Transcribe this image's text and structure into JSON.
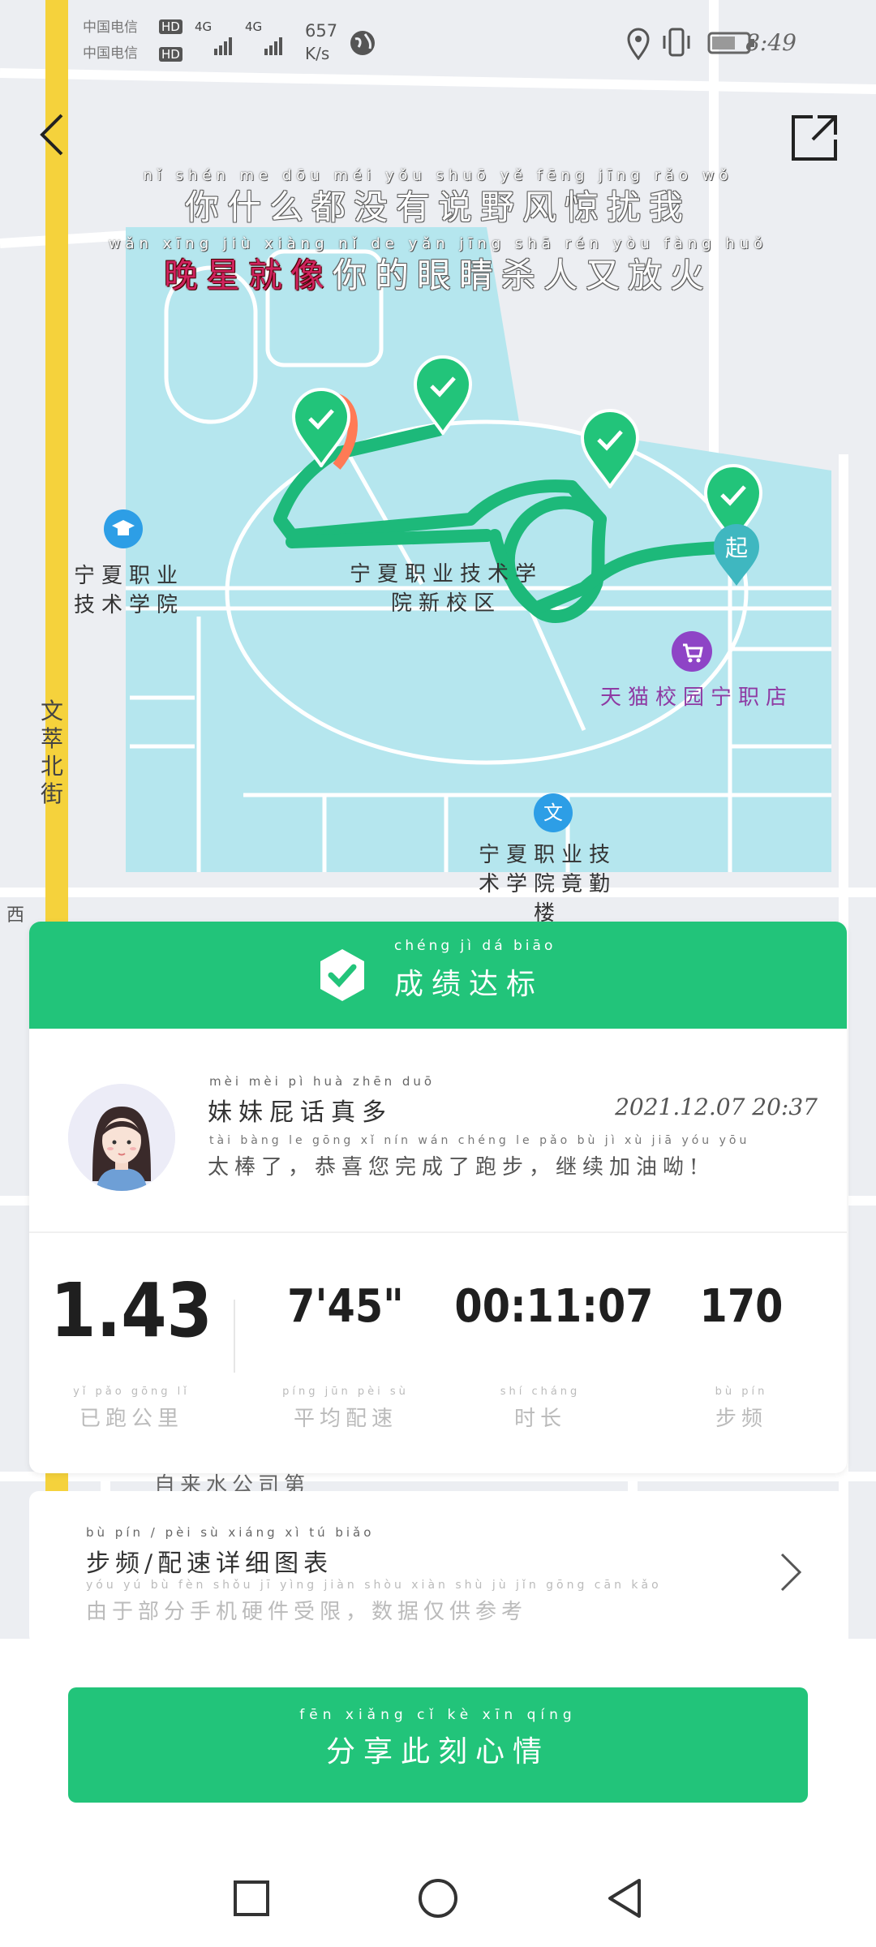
{
  "status_bar": {
    "carrier1": "中国电信",
    "carrier2": "中国电信",
    "hd1": "HD",
    "hd2": "HD",
    "net1": "4G",
    "net2": "4G",
    "speed": "657",
    "speed_unit": "K/s",
    "time": "8:49"
  },
  "lyrics": {
    "line1_pinyin": "nǐ shén me dōu méi yǒu shuō yě fēng jīng rǎo wǒ",
    "line1": "你什么都没有说野风惊扰我",
    "line2_pinyin": "wǎn xīng jiù xiàng nǐ de yǎn jīng shā rén yòu fàng huǒ",
    "line2_highlight": "晚星就像",
    "line2_rest": "你的眼睛杀人又放火"
  },
  "map": {
    "poi_school": "宁夏职业技术学院",
    "poi_new_campus": "宁夏职业技术学院新校区",
    "poi_shop": "天猫校园宁职店",
    "poi_library": "宁夏职业技术学院竟勤楼",
    "street": "文萃北街",
    "poi_water": "自来水公司第",
    "start_marker": "起",
    "edge_char": "西",
    "lib_icon": "文"
  },
  "result": {
    "title": "成绩达标",
    "title_pinyin": "chéng jì dá biāo",
    "user_name": "妹妹屁话真多",
    "user_name_pinyin": "mèi mèi pì huà zhēn duō",
    "timestamp": "2021.12.07 20:37",
    "message": "太棒了，恭喜您完成了跑步，继续加油呦!",
    "message_pinyin": "tài bàng le gōng xǐ nín wán chéng le pǎo bù jì xù jiā yóu yōu"
  },
  "stats": [
    {
      "value": "1.43",
      "label": "已跑公里",
      "pinyin": "yǐ pǎo gōng lǐ"
    },
    {
      "value": "7'45\"",
      "label": "平均配速",
      "pinyin": "píng jūn pèi sù"
    },
    {
      "value": "00:11:07",
      "label": "时长",
      "pinyin": "shí cháng"
    },
    {
      "value": "170",
      "label": "步频",
      "pinyin": "bù pín"
    }
  ],
  "chart_link": {
    "title": "步频/配速详细图表",
    "title_pinyin": "bù pín / pèi sù xiáng xì tú biǎo",
    "subtitle": "由于部分手机硬件受限，数据仅供参考",
    "subtitle_pinyin": "yóu yú bù fèn shǒu jī yìng jiàn shòu xiàn shù jù jǐn gōng cān kǎo"
  },
  "share": {
    "label": "分享此刻心情",
    "pinyin": "fēn xiǎng cǐ kè xīn qíng"
  },
  "colors": {
    "accent": "#22c47a",
    "route": "#1db97a",
    "campus_fill": "#b5e6ee",
    "road_yellow": "#f5d23c",
    "highlight": "#d0235e"
  },
  "icons": [
    "back-arrow-icon",
    "share-out-icon",
    "school-icon",
    "shop-icon",
    "library-icon",
    "check-pin-icon",
    "badge-check-icon",
    "chevron-right-icon",
    "recents-icon",
    "home-icon",
    "back-icon"
  ]
}
